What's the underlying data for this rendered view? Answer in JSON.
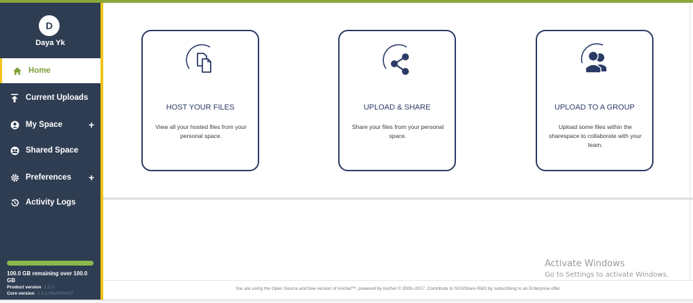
{
  "user": {
    "initial": "D",
    "name": "Daya Yk"
  },
  "nav": {
    "home": "Home",
    "current_uploads": "Current Uploads",
    "my_space": "My Space",
    "shared_space": "Shared Space",
    "preferences": "Preferences",
    "activity_logs": "Activity Logs",
    "expand_symbol": "+"
  },
  "storage": {
    "text": "100.0 GB remaining over 100.0 GB",
    "remaining_fraction": 1.0,
    "product_version_label": "Product version",
    "product_version_value": "1.0.0",
    "core_version_label": "Core version",
    "core_version_value": "2.3.1-SNAPSHOT"
  },
  "cards": [
    {
      "icon": "copy-files-icon",
      "title": "HOST YOUR FILES",
      "description": "View all your hosted files from your personal space."
    },
    {
      "icon": "share-icon",
      "title": "UPLOAD & SHARE",
      "description": "Share your files from your personal space."
    },
    {
      "icon": "group-icon",
      "title": "UPLOAD TO A GROUP",
      "description": "Upload some files within the sharespace to collaborate with your team."
    }
  ],
  "footer": {
    "text": "You are using the Open Source and free version of Anchel™, powered by Anchel © 2009–2017. Contribute to SGSShare R&D by subscribing to an Enterprise offer."
  },
  "watermark": {
    "line1": "Activate Windows",
    "line2": "Go to Settings to activate Windows."
  },
  "colors": {
    "sidebar": "#2e3d52",
    "accent_green": "#7da23a",
    "accent_yellow": "#f0c419",
    "card_border": "#2b3b66"
  }
}
